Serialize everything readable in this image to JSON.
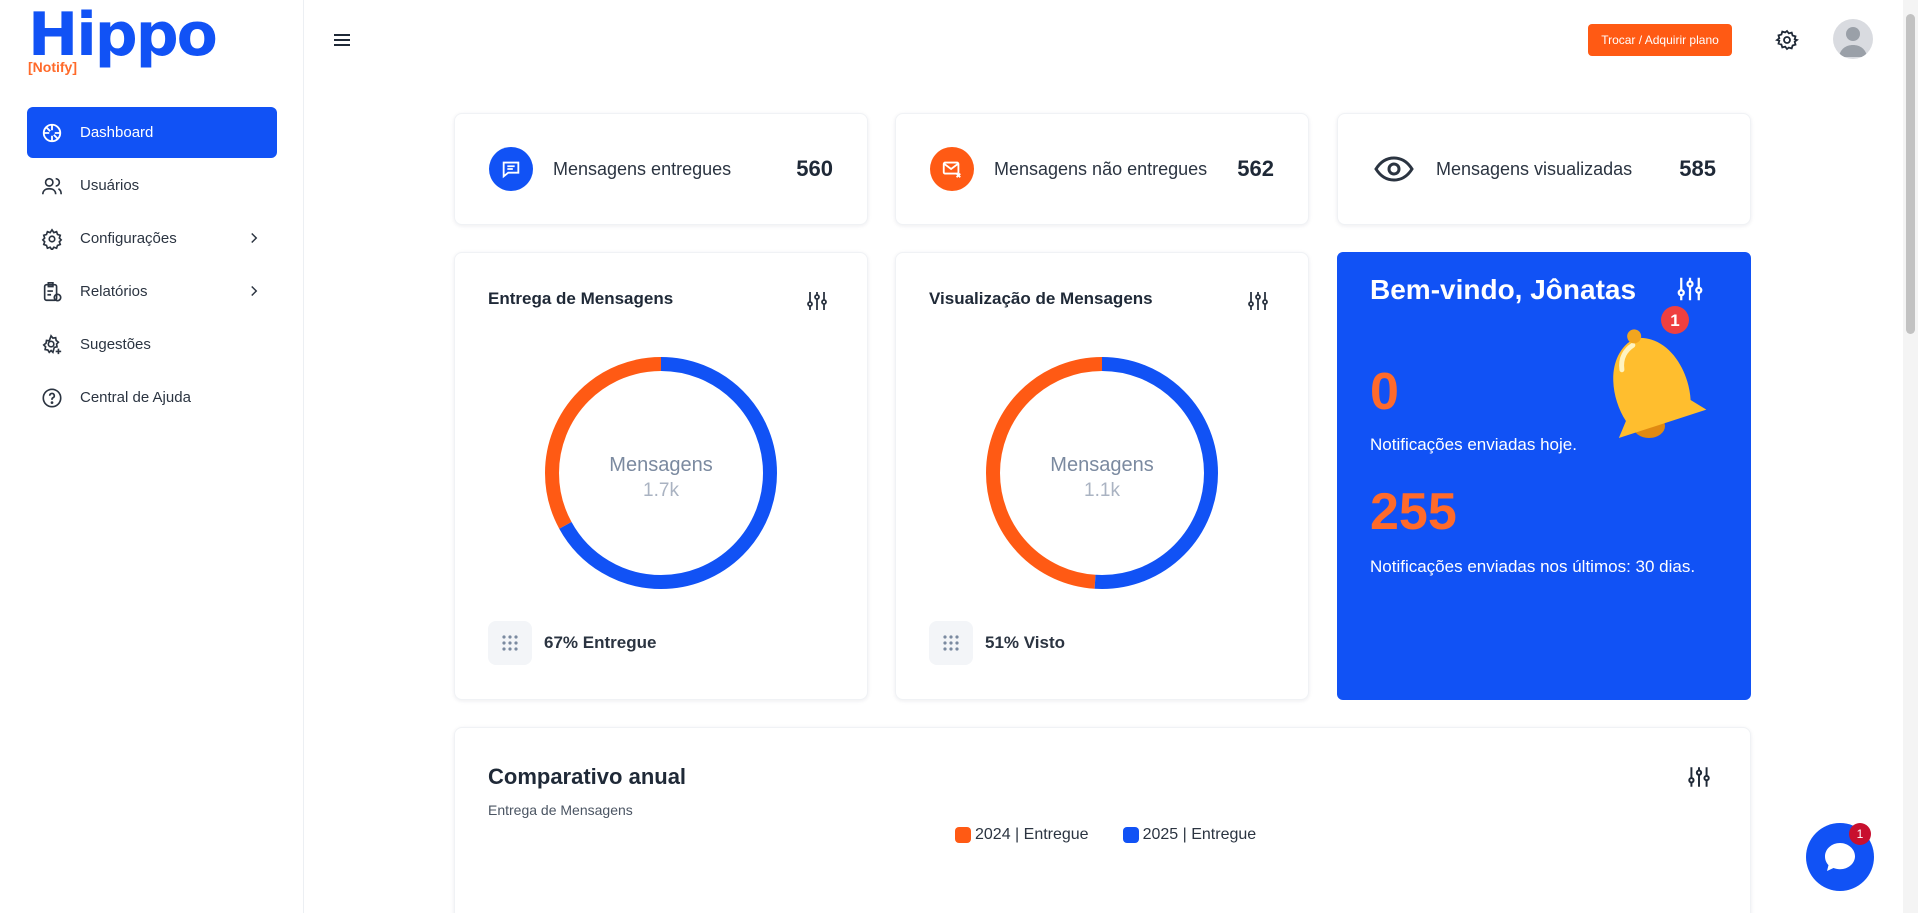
{
  "logo": {
    "word": "Hippo",
    "sub": "[Notify]"
  },
  "sidebar": {
    "items": [
      {
        "label": "Dashboard",
        "icon": "dashboard-icon"
      },
      {
        "label": "Usuários",
        "icon": "users-icon"
      },
      {
        "label": "Configurações",
        "icon": "gear-icon"
      },
      {
        "label": "Relatórios",
        "icon": "report-icon"
      },
      {
        "label": "Sugestões",
        "icon": "suggestion-icon"
      },
      {
        "label": "Central de Ajuda",
        "icon": "help-icon"
      }
    ]
  },
  "topbar": {
    "plan_button": "Trocar / Adquirir plano"
  },
  "stats": [
    {
      "label": "Mensagens entregues",
      "value": "560",
      "color": "#1152f5"
    },
    {
      "label": "Mensagens não entregues",
      "value": "562",
      "color": "#ff5a14"
    },
    {
      "label": "Mensagens visualizadas",
      "value": "585"
    }
  ],
  "charts": [
    {
      "title": "Entrega de Mensagens",
      "center_label": "Mensagens",
      "center_value": "1.7k",
      "footer": "67% Entregue",
      "chart_data": {
        "type": "pie",
        "segments": [
          {
            "name": "Entregue",
            "value": 67,
            "color": "#1152f5"
          },
          {
            "name": "",
            "value": 33,
            "color": "#ff5a14"
          }
        ]
      }
    },
    {
      "title": "Visualização de Mensagens",
      "center_label": "Mensagens",
      "center_value": "1.1k",
      "footer": "51% Visto",
      "chart_data": {
        "type": "pie",
        "segments": [
          {
            "name": "Visto",
            "value": 51,
            "color": "#1152f5"
          },
          {
            "name": "",
            "value": 49,
            "color": "#ff5a14"
          }
        ]
      }
    }
  ],
  "welcome": {
    "title": "Bem-vindo, Jônatas",
    "today_count": "0",
    "today_label": "Notificações enviadas hoje.",
    "month_count": "255",
    "month_label": "Notificações enviadas nos últimos: 30 dias.",
    "bell_badge": "1"
  },
  "annual": {
    "title": "Comparativo anual",
    "subtitle": "Entrega de Mensagens",
    "legend": [
      {
        "label": "2024 | Entregue",
        "color": "#ff5a14"
      },
      {
        "label": "2025 | Entregue",
        "color": "#1152f5"
      }
    ]
  },
  "chat": {
    "badge": "1"
  }
}
